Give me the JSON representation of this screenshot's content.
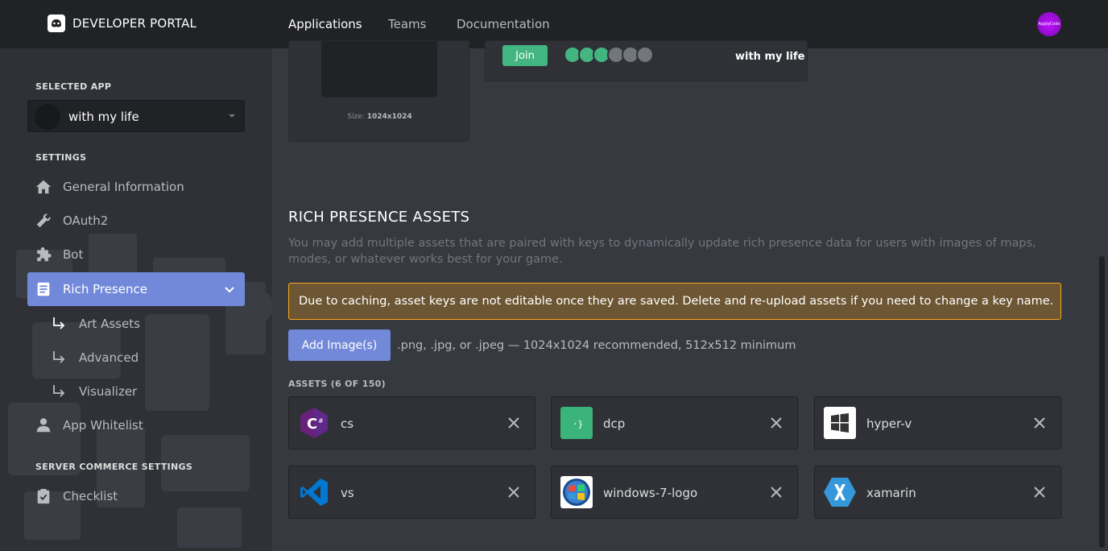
{
  "header": {
    "brand": "DEVELOPER PORTAL",
    "tabs": [
      "Applications",
      "Teams",
      "Documentation"
    ],
    "active_tab": "Applications",
    "avatar_text": "ApplyCode"
  },
  "sidebar": {
    "selected_app_label": "SELECTED APP",
    "selected_app": "with my life",
    "settings_label": "SETTINGS",
    "items": [
      {
        "label": "General Information",
        "icon": "home-icon"
      },
      {
        "label": "OAuth2",
        "icon": "wrench-icon"
      },
      {
        "label": "Bot",
        "icon": "puzzle-icon"
      },
      {
        "label": "Rich Presence",
        "icon": "document-icon"
      }
    ],
    "sub_items": [
      "Art Assets",
      "Advanced",
      "Visualizer"
    ],
    "whitelist": {
      "label": "App Whitelist",
      "icon": "user-icon"
    },
    "commerce_label": "SERVER COMMERCE SETTINGS",
    "checklist": {
      "label": "Checklist",
      "icon": "clipboard-check-icon"
    }
  },
  "preview": {
    "size_prefix": "Size:",
    "size_value": "1024x1024",
    "join_label": "Join",
    "presence_name": "with my life"
  },
  "rich_presence": {
    "title": "RICH PRESENCE ASSETS",
    "description": "You may add multiple assets that are paired with keys to dynamically update rich presence data for users with images of maps, modes, or whatever works best for your game.",
    "warning": "Due to caching, asset keys are not editable once they are saved. Delete and re-upload assets if you need to change a key name.",
    "add_button": "Add Image(s)",
    "hint": ".png, .jpg, or .jpeg — 1024x1024 recommended, 512x512 minimum",
    "assets_label": "ASSETS (6 OF 150)",
    "assets": [
      {
        "name": "cs",
        "icon": "csharp-icon"
      },
      {
        "name": "dcp",
        "icon": "dcp-icon"
      },
      {
        "name": "hyper-v",
        "icon": "hyper-v-icon"
      },
      {
        "name": "vs",
        "icon": "visual-studio-icon"
      },
      {
        "name": "windows-7-logo",
        "icon": "windows-7-logo-icon"
      },
      {
        "name": "xamarin",
        "icon": "xamarin-icon"
      }
    ]
  },
  "colors": {
    "accent": "#7289da",
    "join_green": "#43b581",
    "warning_bg": "#6d5633",
    "warning_border": "#faa61a"
  }
}
